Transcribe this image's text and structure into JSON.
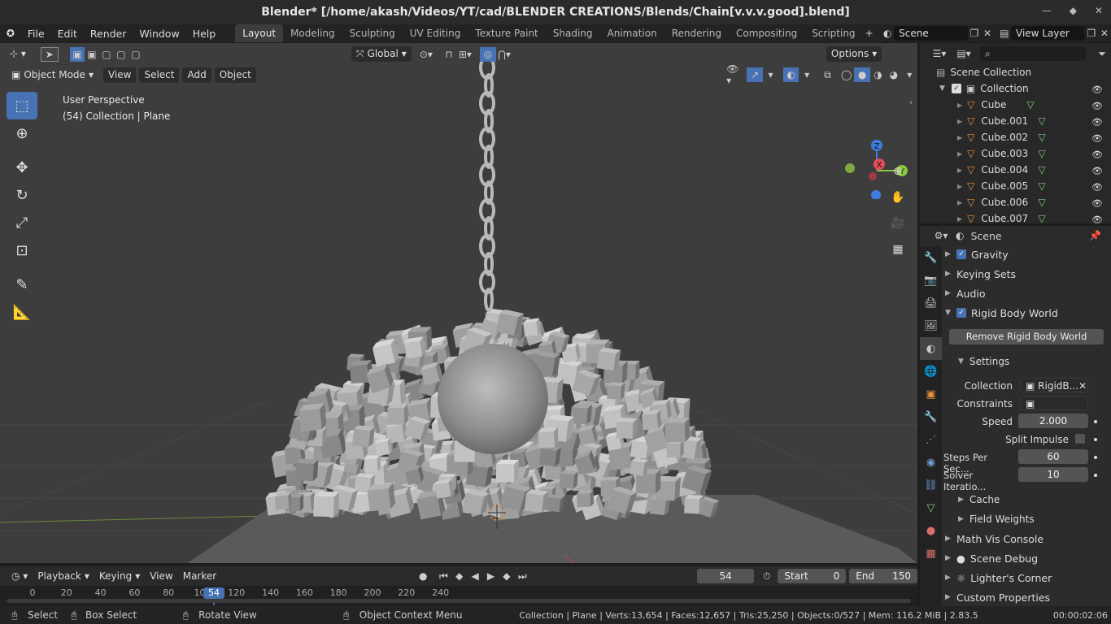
{
  "window": {
    "title": "Blender* [/home/akash/Videos/YT/cad/BLENDER CREATIONS/Blends/Chain[v.v.v.good].blend]"
  },
  "menus": [
    "File",
    "Edit",
    "Render",
    "Window",
    "Help"
  ],
  "workspaces": [
    "Layout",
    "Modeling",
    "Sculpting",
    "UV Editing",
    "Texture Paint",
    "Shading",
    "Animation",
    "Rendering",
    "Compositing",
    "Scripting"
  ],
  "active_workspace": "Layout",
  "scene_field": "Scene",
  "view_layer_field": "View Layer",
  "viewport": {
    "mode": "Object Mode",
    "menus": [
      "View",
      "Select",
      "Add",
      "Object"
    ],
    "transform_orientation": "Global",
    "options": "Options",
    "info_line1": "User Perspective",
    "info_line2": "(54) Collection | Plane",
    "gizmo_axes": {
      "x": "X",
      "y": "Y",
      "z": "Z"
    },
    "colors": {
      "x": "#e44c59",
      "y": "#8cc63f",
      "z": "#3f7ce0",
      "background": "#3d3d3d",
      "active_tool": "#4772b3"
    }
  },
  "outliner": {
    "root": "Scene Collection",
    "collection": "Collection",
    "objects": [
      "Cube",
      "Cube.001",
      "Cube.002",
      "Cube.003",
      "Cube.004",
      "Cube.005",
      "Cube.006",
      "Cube.007"
    ]
  },
  "properties": {
    "context": "Scene",
    "panels": {
      "gravity": "Gravity",
      "keying_sets": "Keying Sets",
      "audio": "Audio",
      "rigid_body_world": "Rigid Body World",
      "remove_button": "Remove Rigid Body World",
      "settings": "Settings",
      "collection_label": "Collection",
      "collection_value": "RigidB...",
      "constraints_label": "Constraints",
      "speed_label": "Speed",
      "speed_value": "2.000",
      "split_impulse": "Split Impulse",
      "steps_label": "Steps Per Sec...",
      "steps_value": "60",
      "solver_label": "Solver Iteratio...",
      "solver_value": "10",
      "cache": "Cache",
      "field_weights": "Field Weights",
      "math_vis": "Math Vis Console",
      "scene_debug": "Scene Debug",
      "lighters_corner": "Lighter's Corner",
      "custom_props": "Custom Properties"
    }
  },
  "timeline": {
    "menus": [
      "Playback",
      "Keying",
      "View",
      "Marker"
    ],
    "current_frame": "54",
    "start_label": "Start",
    "start_value": "0",
    "end_label": "End",
    "end_value": "150",
    "ticks": [
      "0",
      "20",
      "40",
      "60",
      "80",
      "100",
      "120",
      "140",
      "160",
      "180",
      "200",
      "220",
      "240"
    ],
    "playhead_label": "54"
  },
  "status": {
    "select": "Select",
    "box_select": "Box Select",
    "rotate_view": "Rotate View",
    "context_menu": "Object Context Menu",
    "stats": "Collection | Plane | Verts:13,654 | Faces:12,657 | Tris:25,250 | Objects:0/527 | Mem: 116.2 MiB | 2.83.5",
    "time": "00:00:02:06"
  }
}
